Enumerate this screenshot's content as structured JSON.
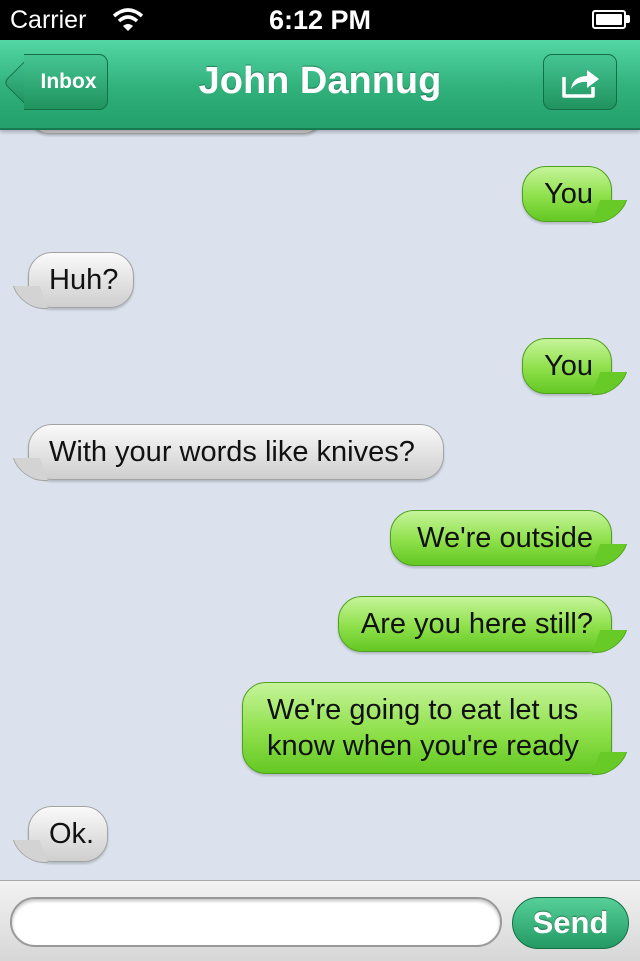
{
  "status_bar": {
    "carrier": "Carrier",
    "time": "6:12 PM"
  },
  "nav": {
    "back_label": "Inbox",
    "title": "John Dannug",
    "share_icon": "share-icon"
  },
  "messages": [
    {
      "dir": "out",
      "text": "You"
    },
    {
      "dir": "in",
      "text": "Huh?"
    },
    {
      "dir": "out",
      "text": "You"
    },
    {
      "dir": "in",
      "text": "With your words like knives?"
    },
    {
      "dir": "out",
      "text": "We're outside"
    },
    {
      "dir": "out",
      "text": "Are you here still?"
    },
    {
      "dir": "out",
      "text": "We're going to eat let us know when you're ready"
    },
    {
      "dir": "in",
      "text": "Ok."
    }
  ],
  "compose": {
    "placeholder": "",
    "value": "",
    "send_label": "Send"
  },
  "colors": {
    "nav_green": "#30b07b",
    "outgoing_bubble": "#8ee04a",
    "incoming_bubble": "#e2e2e2",
    "background": "#dbe2ed"
  }
}
